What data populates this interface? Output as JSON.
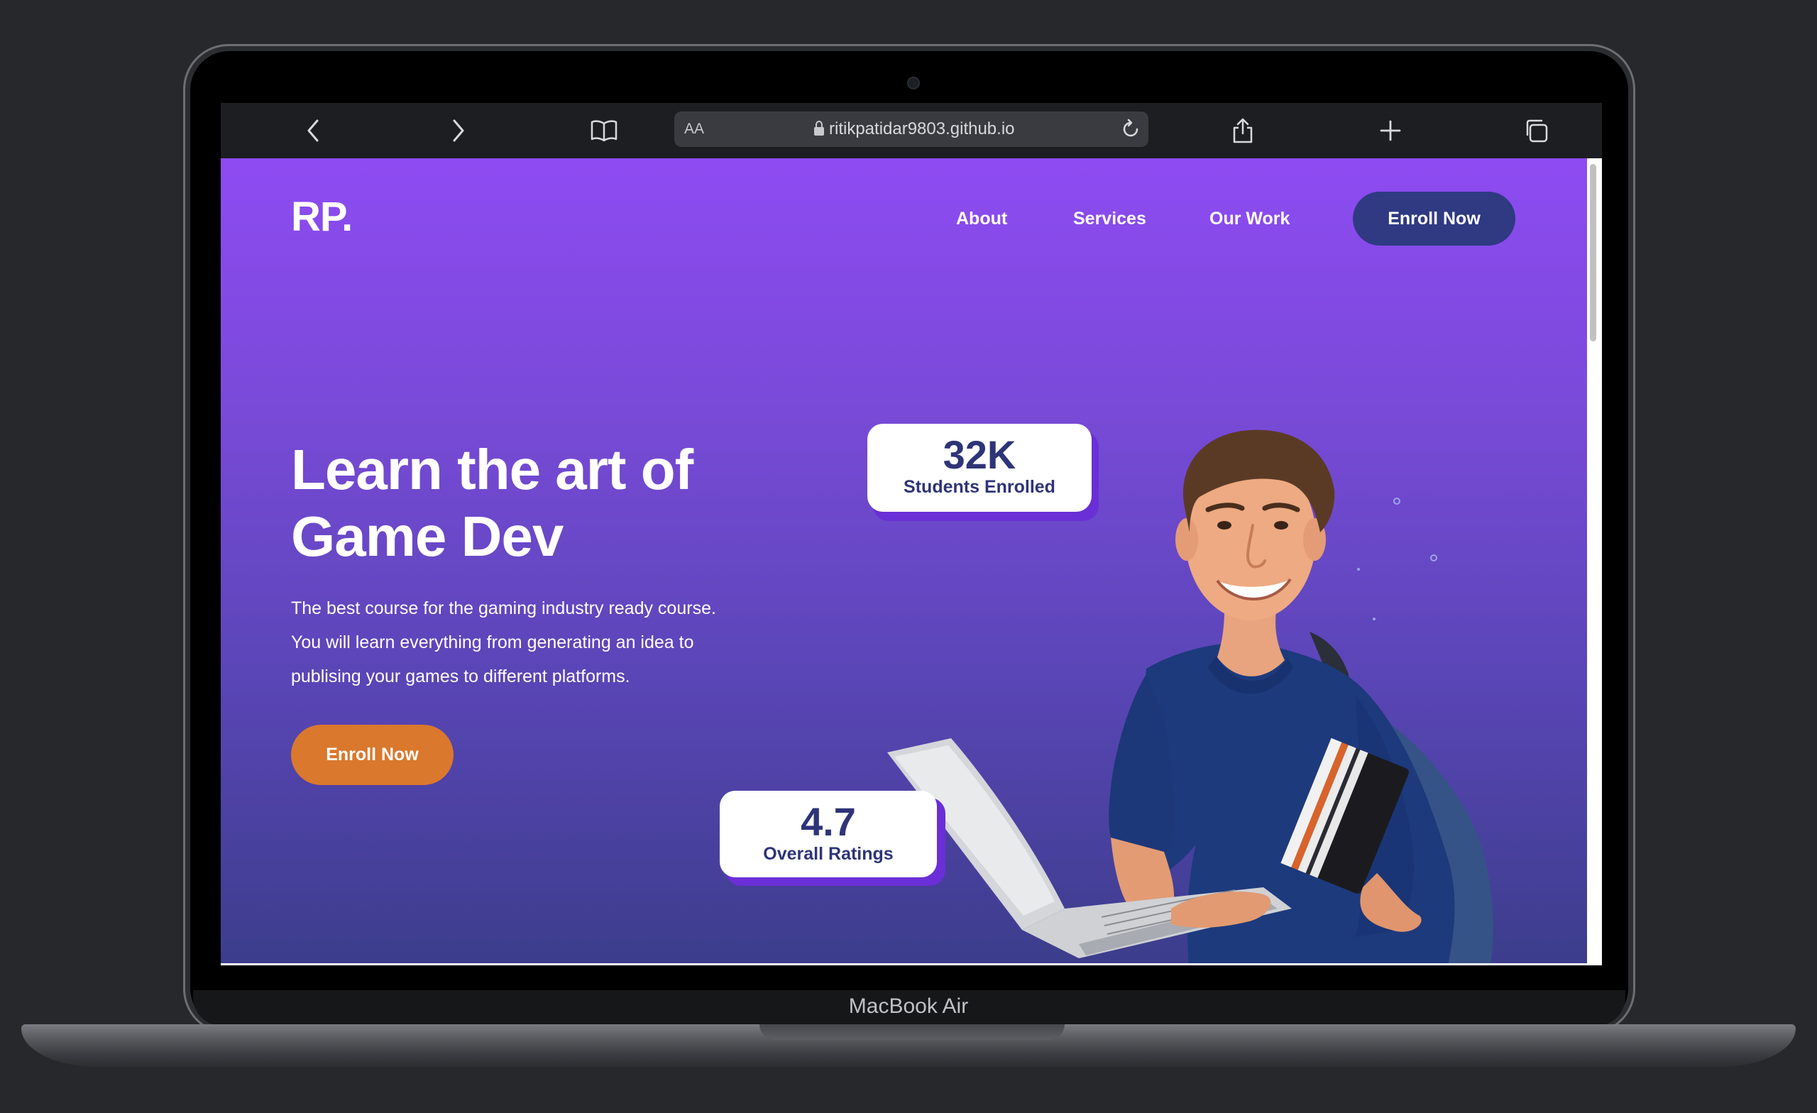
{
  "device": {
    "label": "MacBook Air"
  },
  "browser": {
    "url": "ritikpatidar9803.github.io",
    "text_size_label": "AA",
    "icons": [
      "back-icon",
      "forward-icon",
      "bookmarks-icon",
      "lock-icon",
      "reload-icon",
      "share-icon",
      "new-tab-icon",
      "tabs-icon"
    ]
  },
  "site": {
    "logo": "RP.",
    "nav": [
      "About",
      "Services",
      "Our Work"
    ],
    "nav_cta": "Enroll Now",
    "hero": {
      "title_line1": "Learn the art of",
      "title_line2": "Game Dev",
      "paragraph_lines": [
        "The best course for the gaming industry ready course.",
        "You will learn everything from generating an idea to",
        "publising your games to different platforms."
      ],
      "cta": "Enroll Now"
    },
    "stats": [
      {
        "value": "32K",
        "label": "Students Enrolled"
      },
      {
        "value": "4.7",
        "label": "Overall Ratings"
      }
    ]
  },
  "colors": {
    "gradient_top": "#8e4bf2",
    "gradient_bottom": "#3c3d8c",
    "nav_button": "#2f3a83",
    "hero_button": "#da782d",
    "stat_text": "#2e3477"
  }
}
